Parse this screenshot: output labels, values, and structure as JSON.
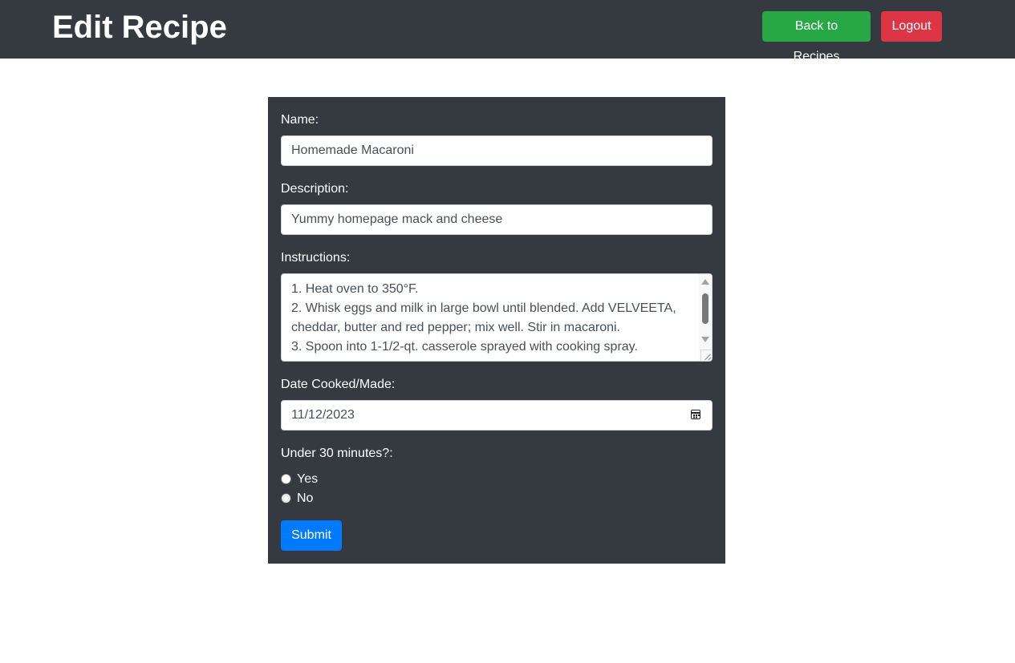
{
  "header": {
    "title": "Edit Recipe",
    "back_label": "Back to Recipes",
    "logout_label": "Logout"
  },
  "form": {
    "name_label": "Name:",
    "name_value": "Homemade Macaroni",
    "description_label": "Description:",
    "description_value": "Yummy homepage mack and cheese",
    "instructions_label": "Instructions:",
    "instructions_value": "1. Heat oven to 350°F.\n2. Whisk eggs and milk in large bowl until blended. Add VELVEETA, cheddar, butter and red pepper; mix well. Stir in macaroni.\n3. Spoon into 1-1/2-qt. casserole sprayed with cooking spray.",
    "date_label": "Date Cooked/Made:",
    "date_value": "11/12/2023",
    "under30_label": "Under 30 minutes?:",
    "yes_label": "Yes",
    "no_label": "No",
    "submit_label": "Submit"
  },
  "icons": {
    "date": "calendar-icon"
  },
  "colors": {
    "header_bg": "#343a40",
    "back_button": "#28a745",
    "logout_button": "#dc3545",
    "submit_button": "#007bff"
  }
}
